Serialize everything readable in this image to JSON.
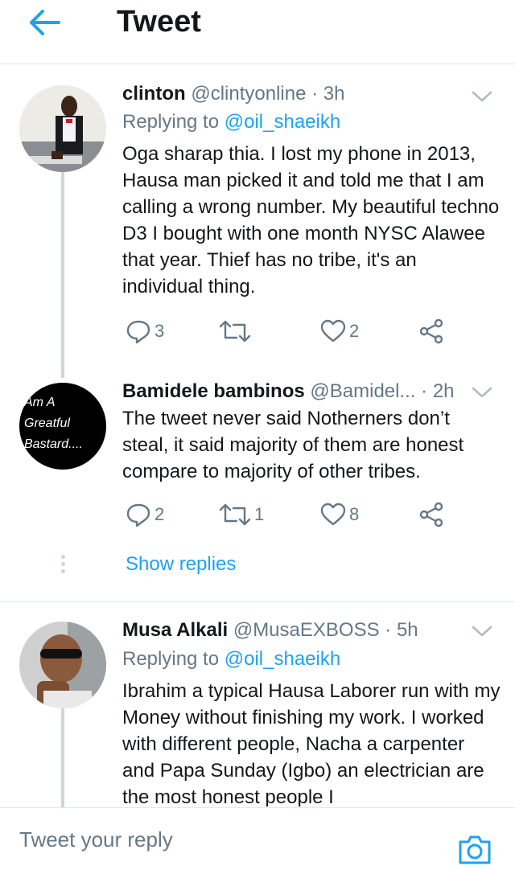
{
  "header": {
    "title": "Tweet"
  },
  "tweets": [
    {
      "name": "clinton",
      "handle": "@clintyonline",
      "time": "3h",
      "replying_prefix": "Replying to ",
      "replying_to": "@oil_shaeikh",
      "body": "Oga sharap thia. I lost my phone in 2013, Hausa man picked it and told me that I am calling a wrong number. My beautiful techno D3 I bought with one month NYSC Alawee that year. Thief has no tribe, it's an individual thing.",
      "replies": "3",
      "retweets": "",
      "likes": "2"
    },
    {
      "name": "Bamidele bambinos",
      "handle": "@Bamidel...",
      "time": "2h",
      "avatar_text": [
        "Am A",
        "Greatful",
        "Bastard...."
      ],
      "body": "The tweet never said Notherners don’t steal, it said majority of them are honest compare to majority of other tribes.",
      "replies": "2",
      "retweets": "1",
      "likes": "8"
    },
    {
      "name": "Musa Alkali",
      "handle": "@MusaEXBOSS",
      "time": "5h",
      "replying_prefix": "Replying to ",
      "replying_to": "@oil_shaeikh",
      "body": "Ibrahim a typical Hausa Laborer run with my Money without finishing my work. I worked with different people, Nacha a carpenter and Papa Sunday (Igbo) an electrician are the most honest people I"
    }
  ],
  "show_replies": "Show replies",
  "composer": {
    "placeholder": "Tweet your reply"
  },
  "colors": {
    "accent": "#1da1f2",
    "muted": "#657786",
    "text": "#14171a",
    "divider": "#e1e8ed"
  }
}
